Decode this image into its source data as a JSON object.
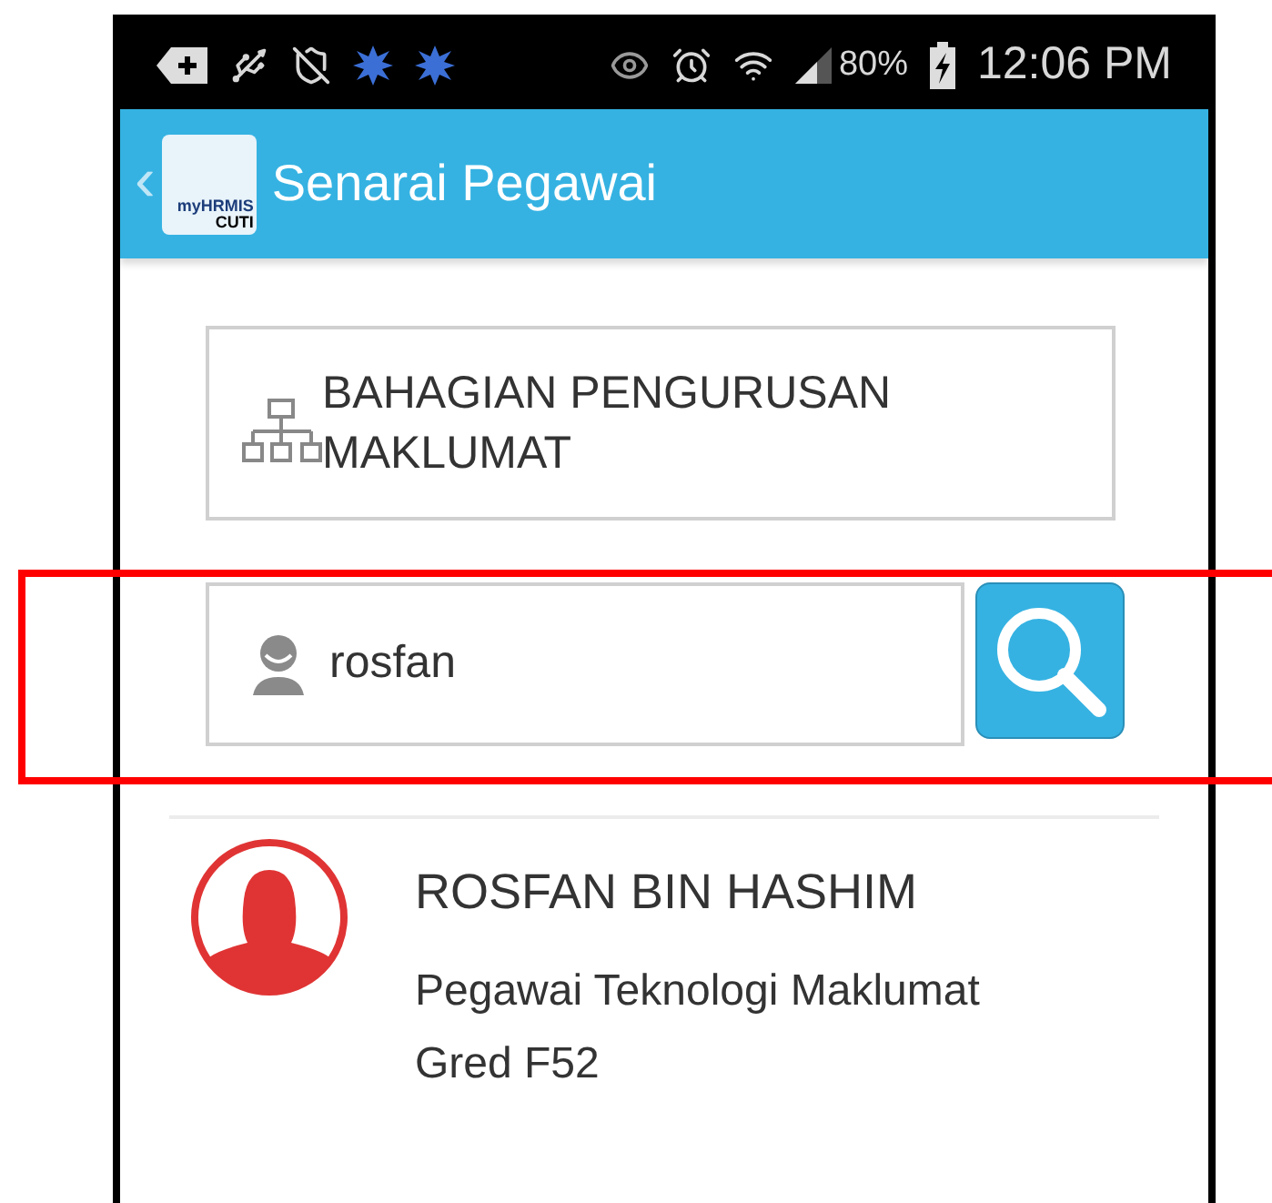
{
  "status_bar": {
    "battery_percent": "80%",
    "time": "12:06 PM"
  },
  "app_bar": {
    "back": "‹",
    "logo": {
      "line_1": "myHRMIS",
      "line_2": "CUTI"
    },
    "title": "Senarai Pegawai"
  },
  "department": {
    "label": "BAHAGIAN PENGURUSAN MAKLUMAT"
  },
  "search": {
    "value": "rosfan"
  },
  "results": [
    {
      "name": "ROSFAN BIN HASHIM",
      "position": "Pegawai Teknologi Maklumat",
      "grade": "Gred F52"
    }
  ]
}
